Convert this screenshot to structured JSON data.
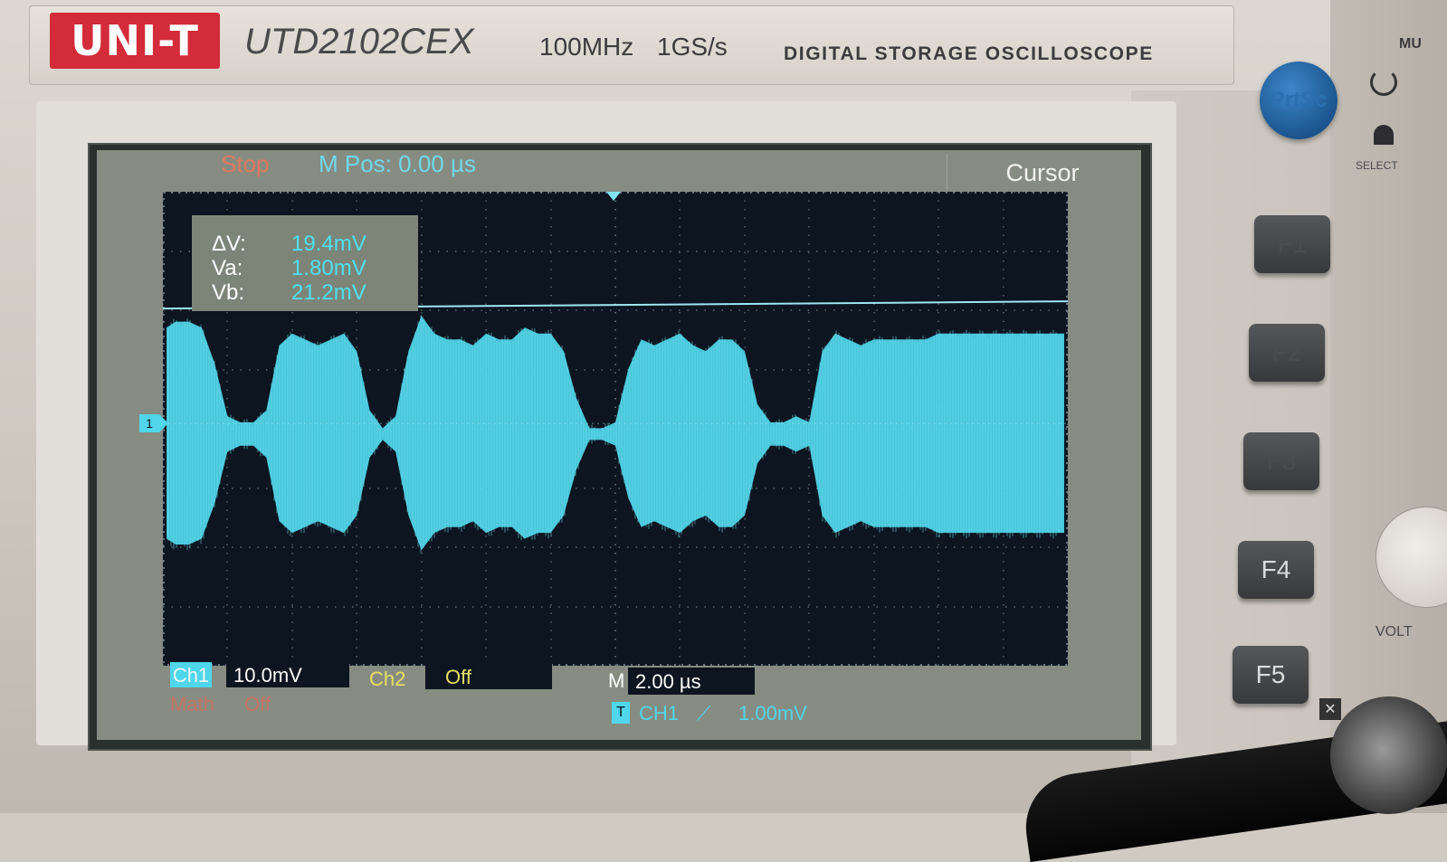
{
  "device": {
    "brand": "UNI-T",
    "model": "UTD2102CEX",
    "bandwidth": "100MHz",
    "sample_rate": "1GS/s",
    "subtitle": "DIGITAL STORAGE OSCILLOSCOPE"
  },
  "status": {
    "run_state": "Stop",
    "mpos": "M Pos: 0.00 µs",
    "menu_title": "Cursor"
  },
  "cursor_readout": {
    "delta_v_label": "ΔV:",
    "delta_v": "19.4mV",
    "va_label": "Va:",
    "va": "1.80mV",
    "vb_label": "Vb:",
    "vb": "21.2mV"
  },
  "channels": {
    "ch1_label": "Ch1",
    "ch1_scale": "10.0mV",
    "ch1_marker": "1",
    "ch2_label": "Ch2",
    "ch2_scale": "Off",
    "math_label": "Math",
    "math_state": "Off"
  },
  "timebase": {
    "m_label": "M",
    "scale": "2.00 µs"
  },
  "trigger": {
    "badge": "T",
    "source": "CH1",
    "slope": "⟋",
    "level": "1.00mV"
  },
  "side_buttons": {
    "prtsc": "PrtSc",
    "select_label": "SELECT",
    "f_keys": [
      "F1",
      "F2",
      "F3",
      "F4",
      "F5"
    ],
    "volts_label": "VOLT",
    "mu_label": "MU"
  },
  "colors": {
    "trace": "#4fd6ea",
    "screen_bg": "#0c1520",
    "grid_dots": "#7d8a96",
    "cursor_line": "#9ee8f2",
    "brand_red": "#d32b3a"
  },
  "chart_data": {
    "type": "line",
    "title": "",
    "xlabel": "",
    "ylabel": "",
    "time_per_div_us": 2.0,
    "volts_per_div_mv": 10.0,
    "x_divisions": 14,
    "y_divisions": 8,
    "cursor_a_mv": 1.8,
    "cursor_b_mv": 21.2,
    "series": [
      {
        "name": "Ch1",
        "x_us": [
          -14,
          -13.6,
          -13.2,
          -12.8,
          -12.4,
          -12.0,
          -11.6,
          -11.2,
          -10.8,
          -10.4,
          -10.0,
          -9.6,
          -9.2,
          -8.8,
          -8.4,
          -8.0,
          -7.6,
          -7.2,
          -6.8,
          -6.4,
          -6.0,
          -5.6,
          -5.2,
          -4.8,
          -4.4,
          -4.0,
          -3.6,
          -3.2,
          -2.8,
          -2.4,
          -2.0,
          -1.6,
          -1.2,
          -0.8,
          -0.4,
          0.0,
          0.4,
          0.8,
          1.2,
          1.6,
          2.0,
          2.4,
          2.8,
          3.2,
          3.6,
          4.0,
          4.4,
          4.8,
          5.2,
          5.6,
          6.0,
          6.4,
          6.8,
          7.2,
          7.6,
          8.0,
          8.4,
          8.8,
          9.2,
          9.6,
          10.0,
          10.4,
          10.8,
          11.2,
          11.6,
          12.0,
          12.4,
          12.8,
          13.2,
          13.6,
          14.0
        ],
        "envelope_mv": [
          18,
          19,
          19,
          18,
          12,
          3,
          2,
          2,
          4,
          15,
          17,
          16,
          15,
          16,
          17,
          14,
          4,
          1,
          3,
          14,
          20,
          17,
          16,
          16,
          15,
          17,
          16,
          16,
          18,
          17,
          17,
          14,
          6,
          1,
          1,
          2,
          11,
          16,
          15,
          16,
          17,
          15,
          14,
          16,
          16,
          14,
          5,
          2,
          2,
          3,
          2,
          14,
          17,
          16,
          15,
          16,
          16,
          16,
          16,
          16,
          17,
          17,
          17,
          17,
          17,
          17,
          17,
          17,
          17,
          17,
          17
        ]
      }
    ]
  }
}
